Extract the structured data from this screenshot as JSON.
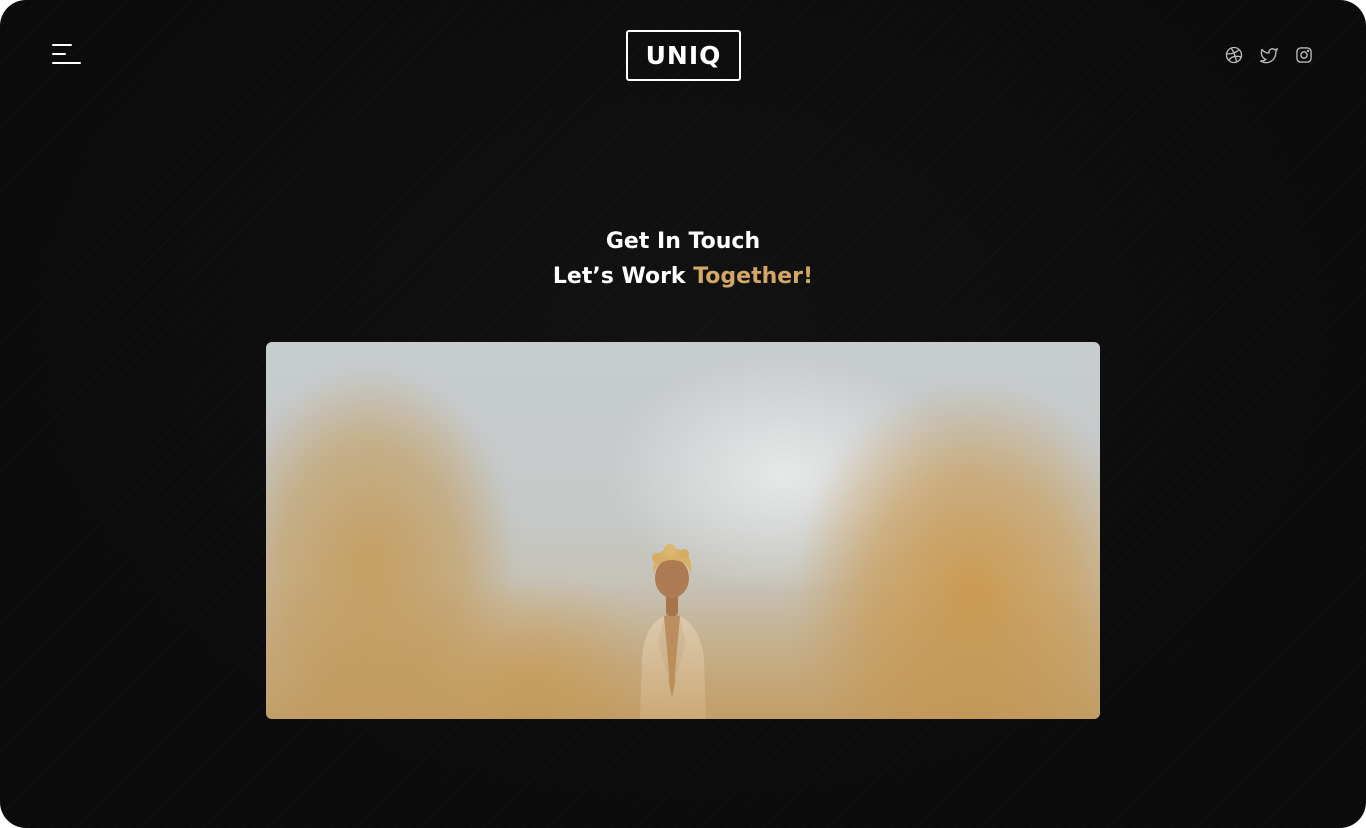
{
  "header": {
    "menu_icon": "hamburger-menu-icon",
    "logo_text": "UNIQ",
    "social": [
      {
        "name": "dribbble",
        "icon": "dribbble-icon"
      },
      {
        "name": "twitter",
        "icon": "twitter-icon"
      },
      {
        "name": "instagram",
        "icon": "instagram-icon"
      }
    ]
  },
  "main": {
    "heading_line1": "Get In Touch",
    "heading_line2_prefix": "Let’s Work ",
    "heading_line2_accent": "Together!",
    "hero_image": "person-in-wheat-field-photo"
  },
  "colors": {
    "background": "#0d0d0d",
    "text": "#ffffff",
    "accent": "#d4a766"
  }
}
